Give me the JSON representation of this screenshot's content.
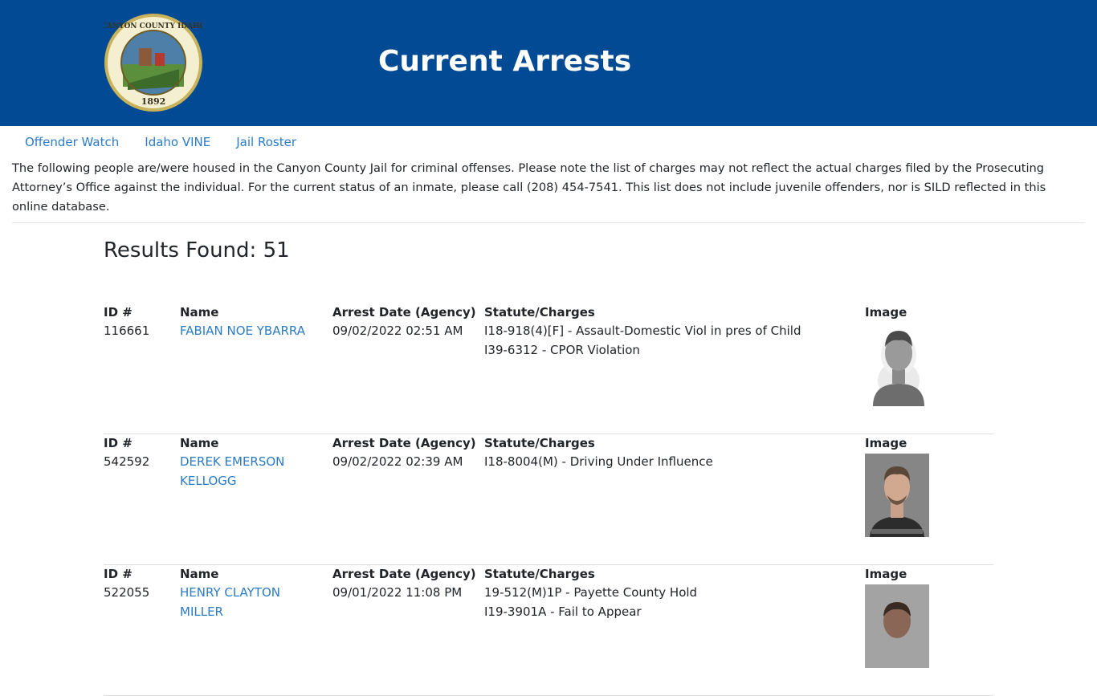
{
  "header": {
    "title": "Current Arrests",
    "seal_text_top": "CANYON COUNTY IDAHO",
    "seal_year": "1892"
  },
  "nav": {
    "items": [
      "Offender Watch",
      "Idaho VINE",
      "Jail Roster"
    ]
  },
  "intro": "The following people are/were housed in the Canyon County Jail for criminal offenses. Please note the list of charges may not reflect the actual charges filed by the Prosecuting Attorney’s Office against the individual. For the current status of an inmate, please call (208) 454-7541. This list does not include juvenile offenders, nor is SILD reflected in this online database.",
  "results": {
    "label": "Results Found: 51"
  },
  "columns": {
    "id": "ID #",
    "name": "Name",
    "date": "Arrest Date (Agency)",
    "charges": "Statute/Charges",
    "image": "Image"
  },
  "records": [
    {
      "id": "116661",
      "name": "FABIAN NOE YBARRA",
      "date": "09/02/2022 02:51 AM",
      "charges": [
        "I18-918(4)[F] - Assault-Domestic Viol in pres of Child",
        "I39-6312 - CPOR Violation"
      ],
      "image_type": "placeholder-avatar"
    },
    {
      "id": "542592",
      "name": "DEREK EMERSON KELLOGG",
      "date": "09/02/2022 02:39 AM",
      "charges": [
        "I18-8004(M) - Driving Under Influence"
      ],
      "image_type": "mugshot"
    },
    {
      "id": "522055",
      "name": "HENRY CLAYTON MILLER",
      "date": "09/01/2022 11:08 PM",
      "charges": [
        "19-512(M)1P - Payette County Hold",
        "I19-3901A - Fail to Appear"
      ],
      "image_type": "mugshot"
    }
  ],
  "colors": {
    "header_bg": "#024b94",
    "link": "#2b7bc7"
  }
}
